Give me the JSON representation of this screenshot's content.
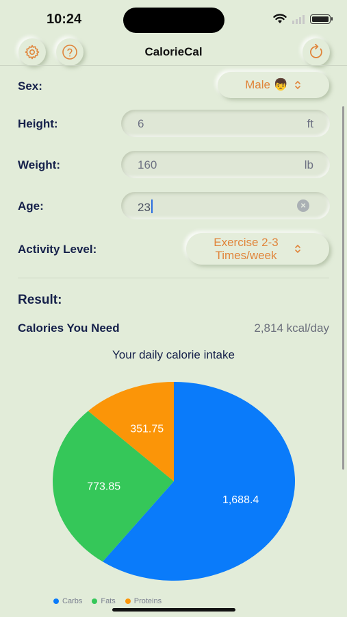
{
  "status_bar": {
    "time": "10:24"
  },
  "nav": {
    "title": "CalorieCal",
    "settings_icon": "gear-icon",
    "help_icon": "question-icon",
    "reset_icon": "refresh-icon"
  },
  "form": {
    "sex": {
      "label": "Sex:",
      "value": "Male 👦",
      "chevron": "⌃⌄"
    },
    "height": {
      "label": "Height:",
      "value": "6",
      "unit": "ft"
    },
    "weight": {
      "label": "Weight:",
      "value": "160",
      "unit": "lb"
    },
    "age": {
      "label": "Age:",
      "value": "23"
    },
    "activity": {
      "label": "Activity Level:",
      "value_line1": "Exercise 2-3",
      "value_line2": "Times/week"
    }
  },
  "result": {
    "title": "Result:",
    "calories_label": "Calories You Need",
    "calories_value": "2,814 kcal/day",
    "chart_title": "Your daily calorie intake"
  },
  "chart_data": {
    "type": "pie",
    "title": "Your daily calorie intake",
    "slices": [
      {
        "name": "Carbs",
        "value": 1688.4,
        "label": "1,688.4",
        "color": "#0a7bfa"
      },
      {
        "name": "Fats",
        "value": 773.85,
        "label": "773.85",
        "color": "#35c759"
      },
      {
        "name": "Proteins",
        "value": 351.75,
        "label": "351.75",
        "color": "#fb9508"
      }
    ],
    "legend": [
      "Carbs",
      "Fats",
      "Proteins"
    ],
    "legend_position": "bottom-left"
  },
  "colors": {
    "accent": "#e0843a",
    "background": "#e2ecd9",
    "text": "#15204a"
  }
}
